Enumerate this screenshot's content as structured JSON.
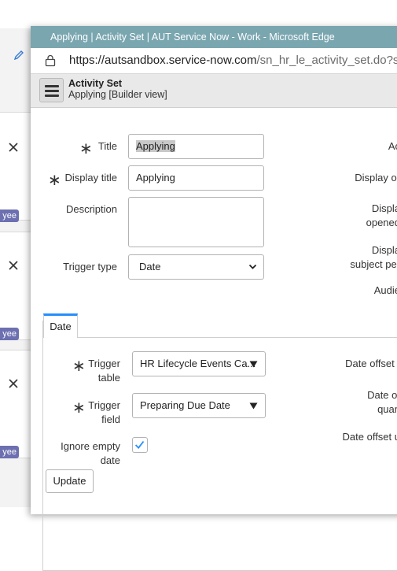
{
  "window": {
    "title": "Applying | Activity Set | AUT Service Now - Work - Microsoft Edge",
    "url_host": "https://autsandbox.service-now.com",
    "url_path": "/sn_hr_le_activity_set.do?syspar"
  },
  "header": {
    "title": "Activity Set",
    "subtitle": "Applying [Builder view]"
  },
  "background": {
    "badge_text": "yee"
  },
  "form": {
    "title_label": "Title",
    "title_value": "Applying",
    "display_title_label": "Display title",
    "display_title_value": "Applying",
    "description_label": "Description",
    "description_value": "",
    "trigger_type_label": "Trigger type",
    "trigger_type_value": "Date",
    "right_labels": {
      "ac": "Ac",
      "display_or": "Display or",
      "displa_1": "Displa",
      "opened": "opened",
      "displa_2": "Displa",
      "subject_per": "subject per",
      "audie": "Audie"
    }
  },
  "section": {
    "tab_label": "Date",
    "trigger_table_label_1": "Trigger",
    "trigger_table_label_2": "table",
    "trigger_table_value": "HR Lifecycle Events Ca...",
    "trigger_field_label_1": "Trigger",
    "trigger_field_label_2": "field",
    "trigger_field_value": "Preparing Due Date",
    "ignore_empty_label_1": "Ignore empty",
    "ignore_empty_label_2": "date",
    "ignore_empty_checked": true,
    "right_labels": {
      "date_offset_t": "Date offset t",
      "date_of": "Date of",
      "quan": "quan",
      "date_offset_u": "Date offset u"
    }
  },
  "footer": {
    "update_label": "Update"
  },
  "colors": {
    "titlebar": "#7aa6b0",
    "tab_accent": "#278efc",
    "badge": "#6c6fb0",
    "check": "#278efc"
  },
  "icons": [
    "edit-pencil-icon",
    "close-icon",
    "lock-icon",
    "hamburger-menu-icon",
    "chevron-down-icon",
    "triangle-down-icon",
    "checkmark-icon"
  ]
}
